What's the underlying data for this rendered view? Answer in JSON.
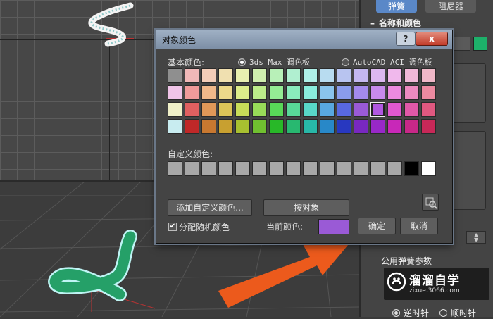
{
  "panel": {
    "tab_spring": "弹簧",
    "tab_damper": "阻尼器",
    "rollout_name_color": "名称和颜色",
    "object_color": "#1db06a",
    "common_params": "公用弹簧参数",
    "radio_ccw": "逆时针",
    "radio_cw": "顺时针",
    "radio_selected": "逆时针"
  },
  "watermark": {
    "brand": "溜溜自学",
    "url": "zixue.3066.com"
  },
  "dialog": {
    "title": "对象颜色",
    "help_label": "?",
    "close_label": "x",
    "basic_colors_label": "基本颜色:",
    "palette_max": "3ds Max 调色板",
    "palette_acad": "AutoCAD ACI 调色板",
    "palette_selected": "3ds Max 调色板",
    "custom_colors_label": "自定义颜色:",
    "add_custom_button": "添加自定义颜色...",
    "by_object_button": "按对象",
    "random_checkbox_label": "分配随机颜色",
    "random_checked": true,
    "check_mark": "✔",
    "current_color_label": "当前颜色:",
    "current_color": "#9a5ad6",
    "ok_button": "确定",
    "cancel_button": "取消",
    "selected_index": [
      2,
      12
    ],
    "basic_colors": [
      [
        "#8f8f8f",
        "#f0b8b8",
        "#f3cdb8",
        "#f0e0b0",
        "#e8efb0",
        "#d0efb0",
        "#b8f0b8",
        "#b0efd0",
        "#b0f0e8",
        "#b8dcf0",
        "#b8c4f0",
        "#c4b8f0",
        "#dcb8f0",
        "#f0b8ec",
        "#f0b8d8",
        "#f0b8c8"
      ],
      [
        "#f0c4e8",
        "#f09a9a",
        "#f0b88a",
        "#ecd88a",
        "#dcec8a",
        "#bcec8a",
        "#94ec94",
        "#8aecbc",
        "#8aecdc",
        "#8ac4ec",
        "#8a9cec",
        "#a48aec",
        "#c88aec",
        "#ec8ae0",
        "#ec8ac0",
        "#ec8aa0"
      ],
      [
        "#f0f0c8",
        "#e06060",
        "#e09858",
        "#dcc458",
        "#c8dc58",
        "#98dc58",
        "#58d858",
        "#58d898",
        "#58d8c8",
        "#58a8e0",
        "#5868e0",
        "#9a5ad6",
        "#b058e0",
        "#e058d0",
        "#e058a8",
        "#e05880"
      ],
      [
        "#c8ecf0",
        "#c02828",
        "#c87830",
        "#c8a030",
        "#a8c030",
        "#70c030",
        "#28b828",
        "#28b870",
        "#28b8a8",
        "#2888c8",
        "#2838c0",
        "#7828c0",
        "#9828c8",
        "#c828b8",
        "#c82888",
        "#c82858"
      ]
    ],
    "custom_colors": [
      "#a8a8a8",
      "#a8a8a8",
      "#a8a8a8",
      "#a8a8a8",
      "#a8a8a8",
      "#a8a8a8",
      "#a8a8a8",
      "#a8a8a8",
      "#a8a8a8",
      "#a8a8a8",
      "#a8a8a8",
      "#a8a8a8",
      "#a8a8a8",
      "#a8a8a8",
      "#000000",
      "#ffffff"
    ]
  },
  "icons": {
    "eyedropper": "eyedropper-icon",
    "spring": "spring-shape",
    "arrow": "pointer-arrow"
  }
}
